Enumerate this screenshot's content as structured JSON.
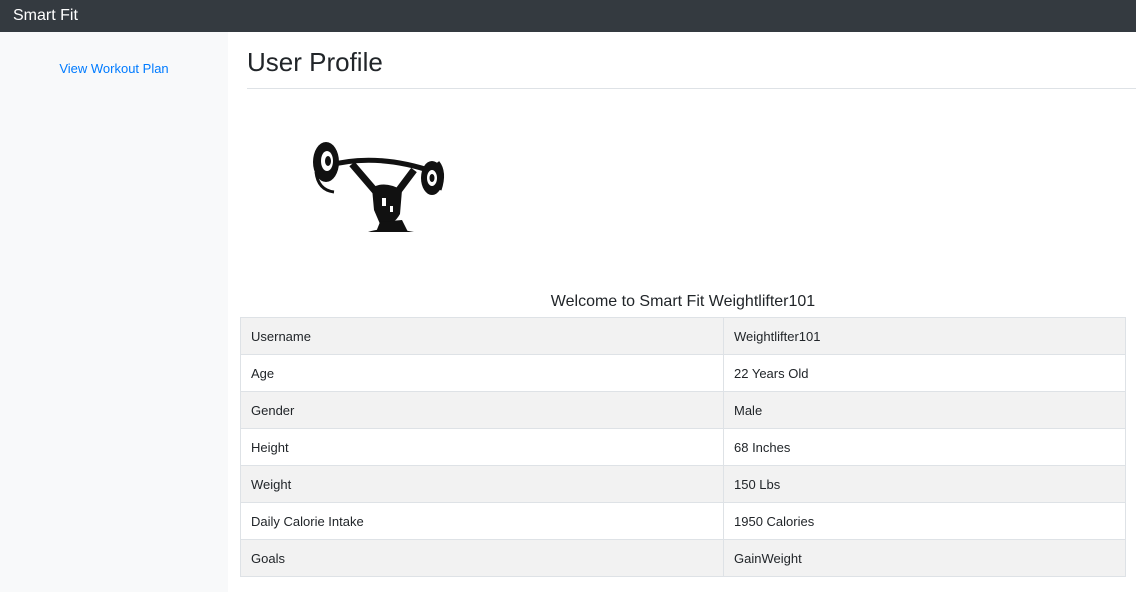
{
  "navbar": {
    "brand": "Smart Fit"
  },
  "sidebar": {
    "items": [
      {
        "label": "View Workout Plan"
      }
    ]
  },
  "main": {
    "title": "User Profile",
    "logo_icon": "weightlifter-icon",
    "welcome_prefix": "Welcome to Smart Fit",
    "username_display": "Weightlifter101",
    "profile_rows": [
      {
        "label": "Username",
        "value": "Weightlifter101"
      },
      {
        "label": "Age",
        "value": "22 Years Old"
      },
      {
        "label": "Gender",
        "value": "Male"
      },
      {
        "label": "Height",
        "value": "68 Inches"
      },
      {
        "label": "Weight",
        "value": "150 Lbs"
      },
      {
        "label": "Daily Calorie Intake",
        "value": "1950 Calories"
      },
      {
        "label": "Goals",
        "value": "GainWeight"
      }
    ]
  },
  "colors": {
    "navbar_bg": "#343a40",
    "sidebar_bg": "#f8f9fa",
    "link": "#007bff",
    "stripe": "#f2f2f2"
  }
}
